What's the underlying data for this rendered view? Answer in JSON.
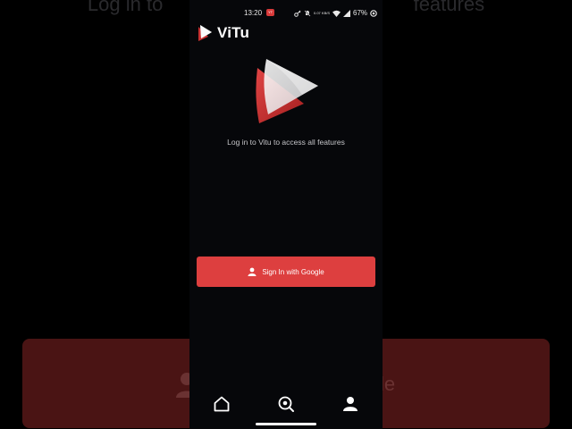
{
  "status_bar": {
    "time": "13:20",
    "notification_badge": "YT",
    "network_speed": "0.07 KB/S",
    "battery": "67%"
  },
  "app": {
    "name": "ViTu",
    "accent_color": "#dd3f3f",
    "background_color": "#06070a"
  },
  "main": {
    "subtitle": "Log in to Vitu to access all features",
    "sign_in_button": {
      "label": "Sign In with Google",
      "icon": "person-icon"
    }
  },
  "background": {
    "headline_left": "Log in to",
    "headline_right": "features",
    "button_text_fragment": "le"
  },
  "bottom_nav": {
    "items": [
      {
        "id": "home",
        "icon": "home-icon"
      },
      {
        "id": "explore",
        "icon": "explore-search-icon"
      },
      {
        "id": "account",
        "icon": "person-icon"
      }
    ]
  }
}
